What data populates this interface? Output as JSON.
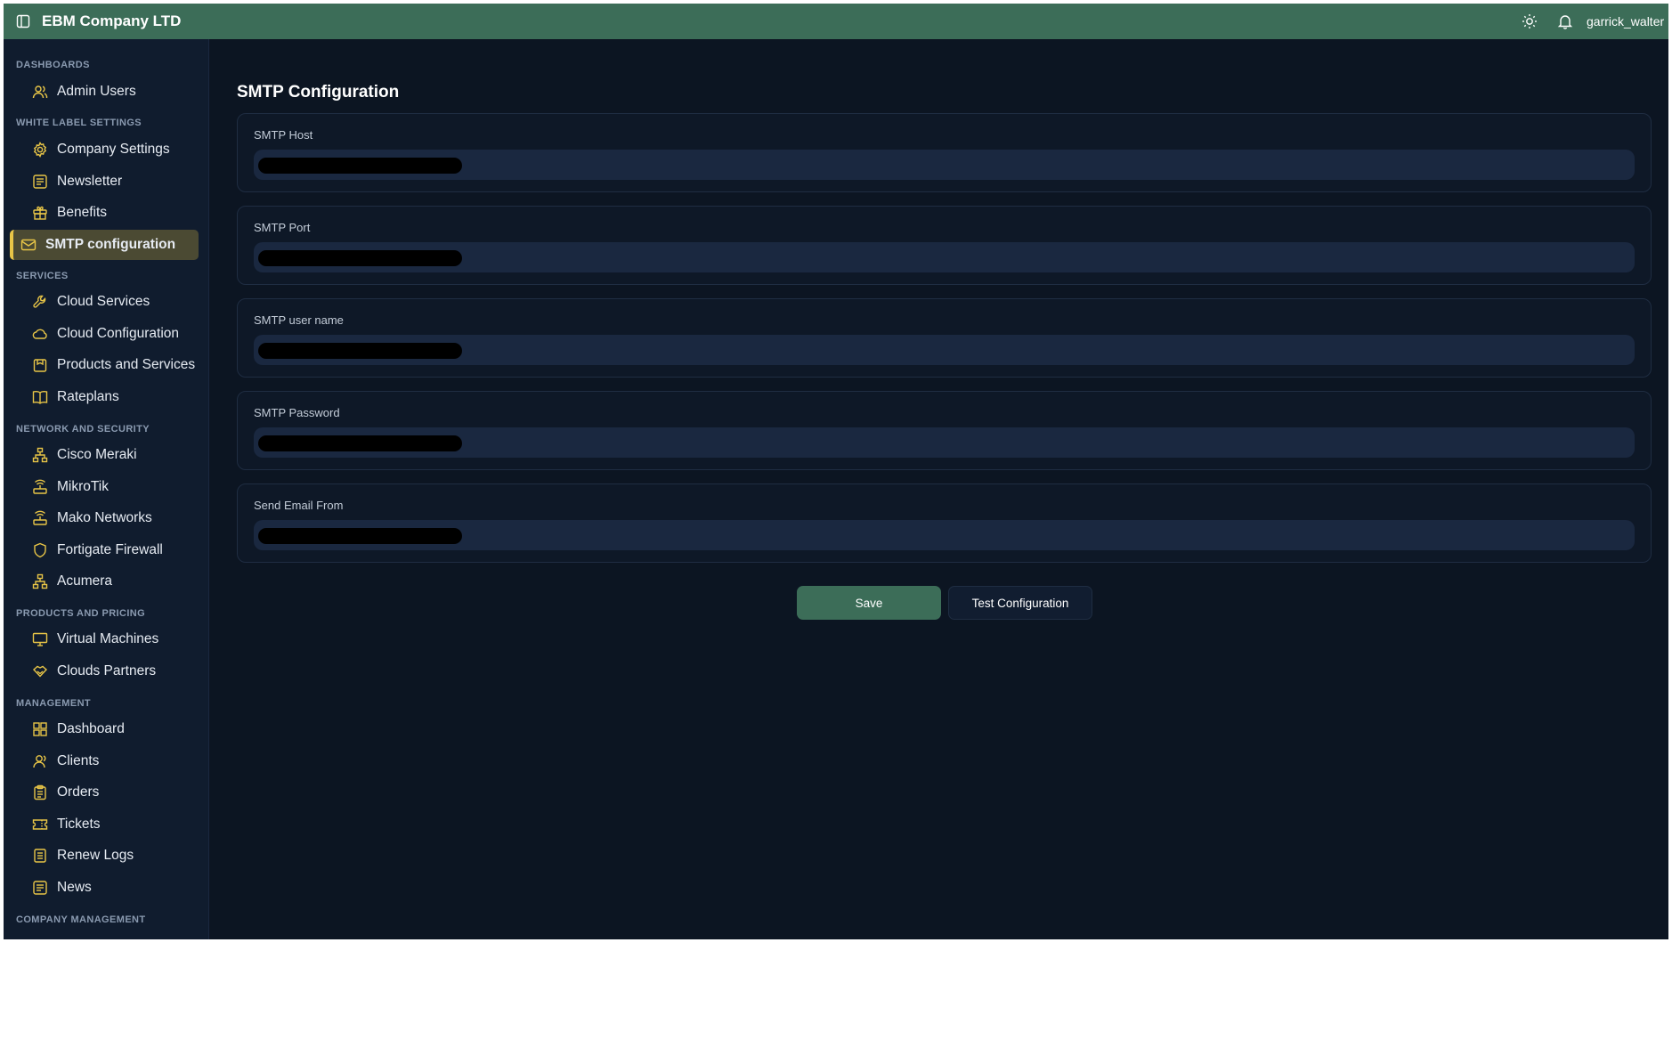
{
  "header": {
    "brand": "EBM Company LTD",
    "username": "garrick_walter",
    "icons": [
      "sidebar-toggle-icon",
      "sun-icon",
      "bell-icon"
    ],
    "background_color": "#3c6d58"
  },
  "sidebar": {
    "sections": [
      {
        "title": "DASHBOARDS",
        "items": [
          {
            "label": "Admin Users",
            "icon": "users-icon"
          }
        ]
      },
      {
        "title": "WHITE LABEL SETTINGS",
        "items": [
          {
            "label": "Company Settings",
            "icon": "gear-icon"
          },
          {
            "label": "Newsletter",
            "icon": "newspaper-icon"
          },
          {
            "label": "Benefits",
            "icon": "gift-icon"
          },
          {
            "label": "SMTP configuration",
            "icon": "mail-icon",
            "active": true
          }
        ]
      },
      {
        "title": "SERVICES",
        "items": [
          {
            "label": "Cloud Services",
            "icon": "wrench-icon"
          },
          {
            "label": "Cloud Configuration",
            "icon": "cloud-icon"
          },
          {
            "label": "Products and Services",
            "icon": "package-icon"
          },
          {
            "label": "Rateplans",
            "icon": "book-icon"
          }
        ]
      },
      {
        "title": "NETWORK AND SECURITY",
        "items": [
          {
            "label": "Cisco Meraki",
            "icon": "network-icon"
          },
          {
            "label": "MikroTik",
            "icon": "router-icon"
          },
          {
            "label": "Mako Networks",
            "icon": "router-icon"
          },
          {
            "label": "Fortigate Firewall",
            "icon": "shield-icon"
          },
          {
            "label": "Acumera",
            "icon": "network-icon"
          }
        ]
      },
      {
        "title": "PRODUCTS AND PRICING",
        "items": [
          {
            "label": "Virtual Machines",
            "icon": "monitor-icon"
          },
          {
            "label": "Clouds Partners",
            "icon": "handshake-icon"
          }
        ]
      },
      {
        "title": "MANAGEMENT",
        "items": [
          {
            "label": "Dashboard",
            "icon": "dashboard-icon"
          },
          {
            "label": "Clients",
            "icon": "user-icon"
          },
          {
            "label": "Orders",
            "icon": "clipboard-icon"
          },
          {
            "label": "Tickets",
            "icon": "ticket-icon"
          },
          {
            "label": "Renew Logs",
            "icon": "log-icon"
          },
          {
            "label": "News",
            "icon": "newspaper-icon"
          }
        ]
      },
      {
        "title": "COMPANY MANAGEMENT",
        "items": []
      }
    ],
    "accent_color": "#e8c547"
  },
  "main": {
    "title": "SMTP Configuration",
    "fields": [
      {
        "label": "SMTP Host",
        "value": ""
      },
      {
        "label": "SMTP Port",
        "value": ""
      },
      {
        "label": "SMTP user name",
        "value": ""
      },
      {
        "label": "SMTP Password",
        "value": ""
      },
      {
        "label": "Send Email From",
        "value": ""
      }
    ],
    "save_label": "Save",
    "test_label": "Test Configuration"
  }
}
